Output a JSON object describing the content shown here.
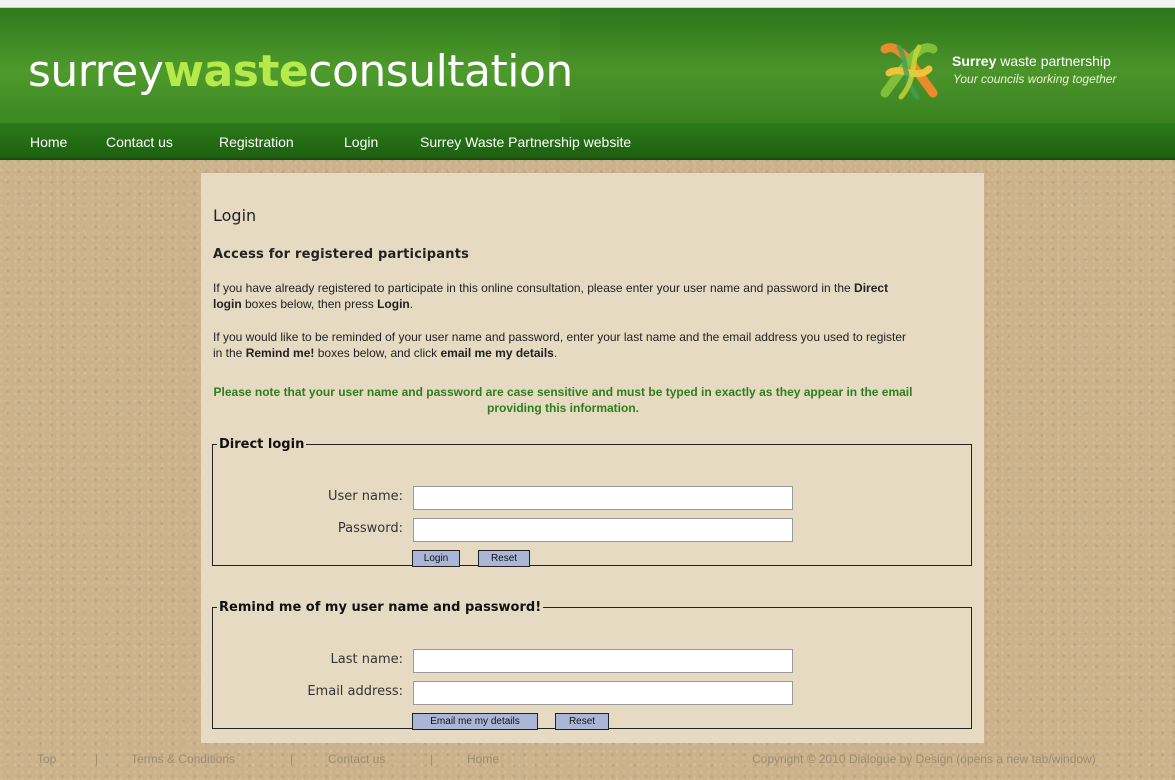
{
  "header": {
    "title_part1": "surrey",
    "title_part2": "waste",
    "title_part3": "consultation",
    "partner_name_bold": "Surrey",
    "partner_name_rest": " waste partnership",
    "partner_tagline": "Your councils working together"
  },
  "nav": {
    "items": [
      "Home",
      "Contact us",
      "Registration",
      "Login",
      "Surrey Waste Partnership website"
    ]
  },
  "main": {
    "title": "Login",
    "subtitle": "Access for registered participants",
    "para1_a": "If you have already registered to participate in this online consultation, please enter your user name and password in the ",
    "para1_b": "Direct login",
    "para1_c": " boxes below, then press ",
    "para1_d": "Login",
    "para1_e": ".",
    "para2_a": "If you would like to be reminded of your user name and password, enter your last name and the email address you used to register in the ",
    "para2_b": "Remind me!",
    "para2_c": " boxes below, and click ",
    "para2_d": "email me my details",
    "para2_e": ".",
    "note": "Please note that your user name and password are case sensitive and must be typed in exactly as they appear in the email providing this information."
  },
  "direct_login": {
    "legend": "Direct login",
    "username_label": "User name:",
    "username_value": "",
    "password_label": "Password:",
    "password_value": "",
    "login_button": "Login",
    "reset_button": "Reset"
  },
  "remind": {
    "legend": "Remind me of my user name and password!",
    "lastname_label": "Last name:",
    "lastname_value": "",
    "email_label": "Email address:",
    "email_value": "",
    "email_button": "Email me my details",
    "reset_button": "Reset"
  },
  "footer": {
    "top": "Top",
    "sep": "|",
    "terms": "Terms & Conditions",
    "contact": "Contact us",
    "home": "Home",
    "copyright": "Copyright © 2010  Dialogue by Design (opens a new tab/window)"
  },
  "colors": {
    "header_green": "#3c8822",
    "nav_green": "#1d6010",
    "accent_lime": "#b6ea4a",
    "note_green": "#2d7f1e",
    "content_bg": "#e7dac2",
    "page_bg": "#cbb28b",
    "button_blue": "#a9b6d5"
  }
}
